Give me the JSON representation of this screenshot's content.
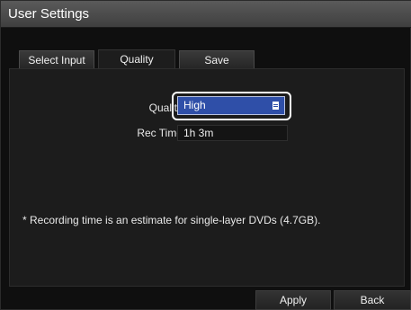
{
  "window": {
    "title": "User Settings"
  },
  "tabs": [
    {
      "label": "Select Input"
    },
    {
      "label": "Quality",
      "selected": true
    },
    {
      "label": "Save"
    }
  ],
  "form": {
    "quality_label": "Quality",
    "quality_value": "High",
    "rec_time_label": "Rec Time",
    "rec_time_value": "1h 3m"
  },
  "note": "* Recording time is an estimate for single-layer DVDs (4.7GB).",
  "footer": {
    "apply_label": "Apply",
    "back_label": "Back"
  },
  "colors": {
    "select_background": "#2f4fa8",
    "focus_ring": "#ffffff",
    "panel_background": "#1c1c1c"
  },
  "icons": {
    "dropdown": "list-icon"
  }
}
